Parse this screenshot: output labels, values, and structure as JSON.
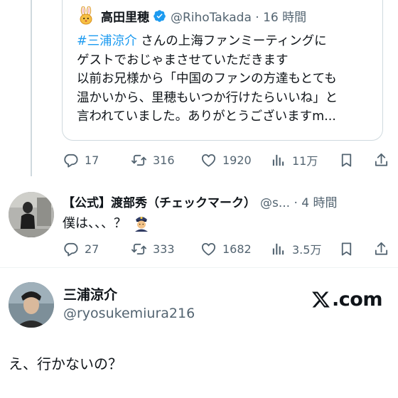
{
  "quoted_tweet": {
    "display_name": "高田里穂",
    "handle_time": "@RihoTakada · 16 時間",
    "body_lines": [
      {
        "hashtag": "#三浦涼介",
        "text": " さんの上海ファンミーティングに"
      },
      {
        "hashtag": "",
        "text": "ゲストでおじゃまさせていただきます"
      },
      {
        "hashtag": "",
        "text": "以前お兄様から「中国のファンの方達もとても"
      },
      {
        "hashtag": "",
        "text": "温かいから、里穂もいつか行けたらいいね」と"
      },
      {
        "hashtag": "",
        "text": "言われていました。ありがとうございますm..."
      }
    ],
    "actions": {
      "replies": "17",
      "reposts": "316",
      "likes": "1920",
      "views": "11万"
    }
  },
  "reply_tweet": {
    "display_name": "【公式】渡部秀（チェックマーク）",
    "handle_time": "@s... · 4 時間",
    "text": "僕は、、、？",
    "actions": {
      "replies": "27",
      "reposts": "333",
      "likes": "1682",
      "views": "3.5万"
    }
  },
  "author": {
    "display_name": "三浦涼介",
    "handle": "@ryosukemiura216"
  },
  "branding": {
    "site": ".com"
  },
  "post": {
    "text": "え、行かないの？"
  },
  "colors": {
    "accent": "#1d9bf0",
    "secondary_text": "#536471",
    "border": "#cfd9de"
  }
}
